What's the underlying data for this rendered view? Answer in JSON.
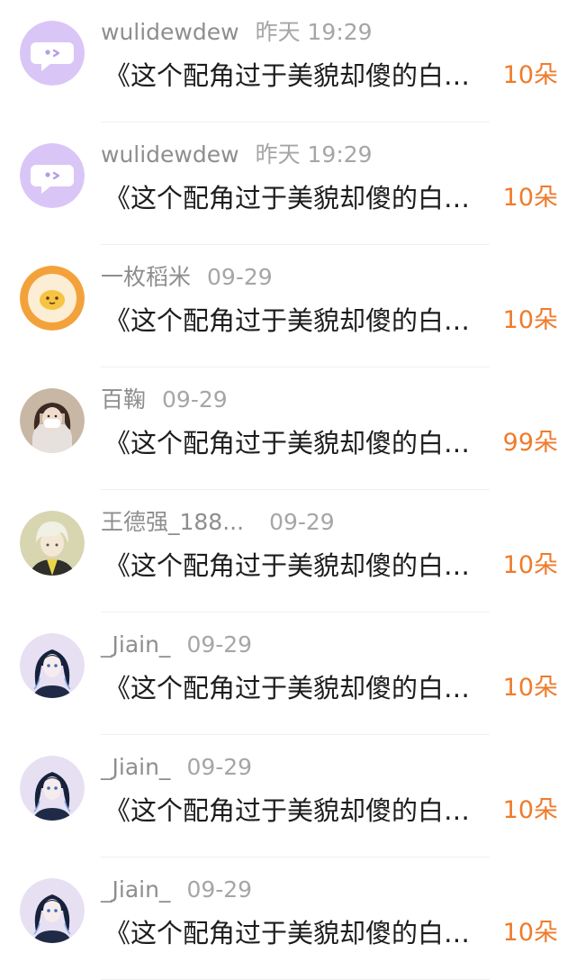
{
  "accent_color": "#ef7b2c",
  "items": [
    {
      "name": "wulidewdew",
      "time": "昨天 19:29",
      "message": "《这个配角过于美貌却傻的白月光》",
      "amount": "10朵",
      "avatar": "chat-bubble-icon"
    },
    {
      "name": "wulidewdew",
      "time": "昨天 19:29",
      "message": "《这个配角过于美貌却傻的白月光》",
      "amount": "10朵",
      "avatar": "chat-bubble-icon"
    },
    {
      "name": "一枚稻米",
      "time": "09-29",
      "message": "《这个配角过于美貌却傻的白月光》",
      "amount": "10朵",
      "avatar": "egg-avatar"
    },
    {
      "name": "百鞠",
      "time": "09-29",
      "message": "《这个配角过于美貌却傻的白月光》",
      "amount": "99朵",
      "avatar": "portrait-avatar"
    },
    {
      "name": "王德强_188...",
      "time": "09-29",
      "message": "《这个配角过于美貌却傻的白月光》",
      "amount": "10朵",
      "avatar": "anime-avatar"
    },
    {
      "name": "_Jiain_",
      "time": "09-29",
      "message": "《这个配角过于美貌却傻的白月光》",
      "amount": "10朵",
      "avatar": "anime-girl-avatar"
    },
    {
      "name": "_Jiain_",
      "time": "09-29",
      "message": "《这个配角过于美貌却傻的白月光》",
      "amount": "10朵",
      "avatar": "anime-girl-avatar"
    },
    {
      "name": "_Jiain_",
      "time": "09-29",
      "message": "《这个配角过于美貌却傻的白月光》",
      "amount": "10朵",
      "avatar": "anime-girl-avatar"
    }
  ]
}
